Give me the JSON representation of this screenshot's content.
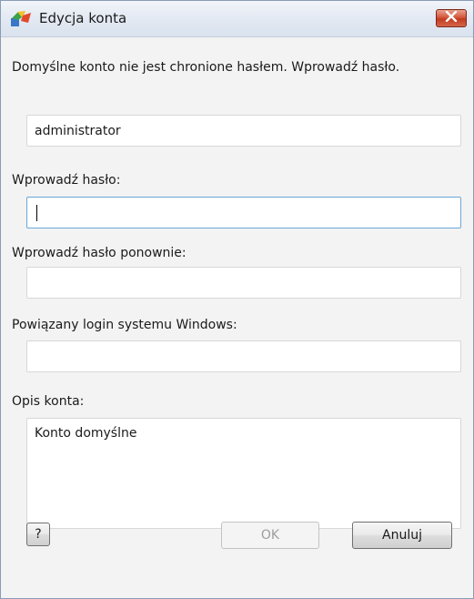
{
  "window": {
    "title": "Edycja konta",
    "icon": "avg-logo-icon",
    "close_icon": "close-icon"
  },
  "dialog": {
    "message": "Domyślne konto nie jest chronione hasłem. Wprowadź hasło.",
    "username_value": "administrator",
    "password_label": "Wprowadź hasło:",
    "password_value": "",
    "password_confirm_label": "Wprowadź hasło ponownie:",
    "password_confirm_value": "",
    "windows_login_label": "Powiązany login systemu Windows:",
    "windows_login_value": "",
    "description_label": "Opis konta:",
    "description_value": "Konto domyślne"
  },
  "buttons": {
    "help_label": "?",
    "ok_label": "OK",
    "cancel_label": "Anuluj"
  },
  "colors": {
    "close_button": "#c9452a",
    "focus_border": "#6aa7d8"
  }
}
